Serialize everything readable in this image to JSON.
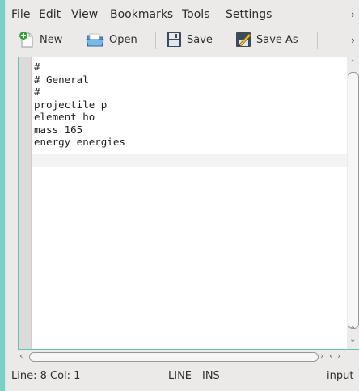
{
  "menubar": {
    "items": [
      {
        "label": "File"
      },
      {
        "label": "Edit"
      },
      {
        "label": "View"
      },
      {
        "label": "Bookmarks"
      },
      {
        "label": "Tools"
      },
      {
        "label": "Settings"
      }
    ],
    "overflow": "›"
  },
  "toolbar": {
    "new_label": "New",
    "open_label": "Open",
    "save_label": "Save",
    "save_as_label": "Save As",
    "overflow": "›"
  },
  "editor": {
    "lines": [
      "#",
      "# General",
      "#",
      "projectile p",
      "element ho",
      "mass 165",
      "energy energies",
      ""
    ]
  },
  "statusbar": {
    "position": "Line: 8 Col: 1",
    "mode_line": "LINE",
    "mode_ins": "INS",
    "filetype": "input"
  },
  "colors": {
    "accent": "#5ec4ba",
    "window_edge": "#79d1c8",
    "background": "#eceae8",
    "editor_background": "#ffffff"
  },
  "icons": {
    "new": "document-new-icon",
    "open": "folder-open-icon",
    "save": "floppy-disk-icon",
    "save_as": "save-as-pen-icon"
  }
}
